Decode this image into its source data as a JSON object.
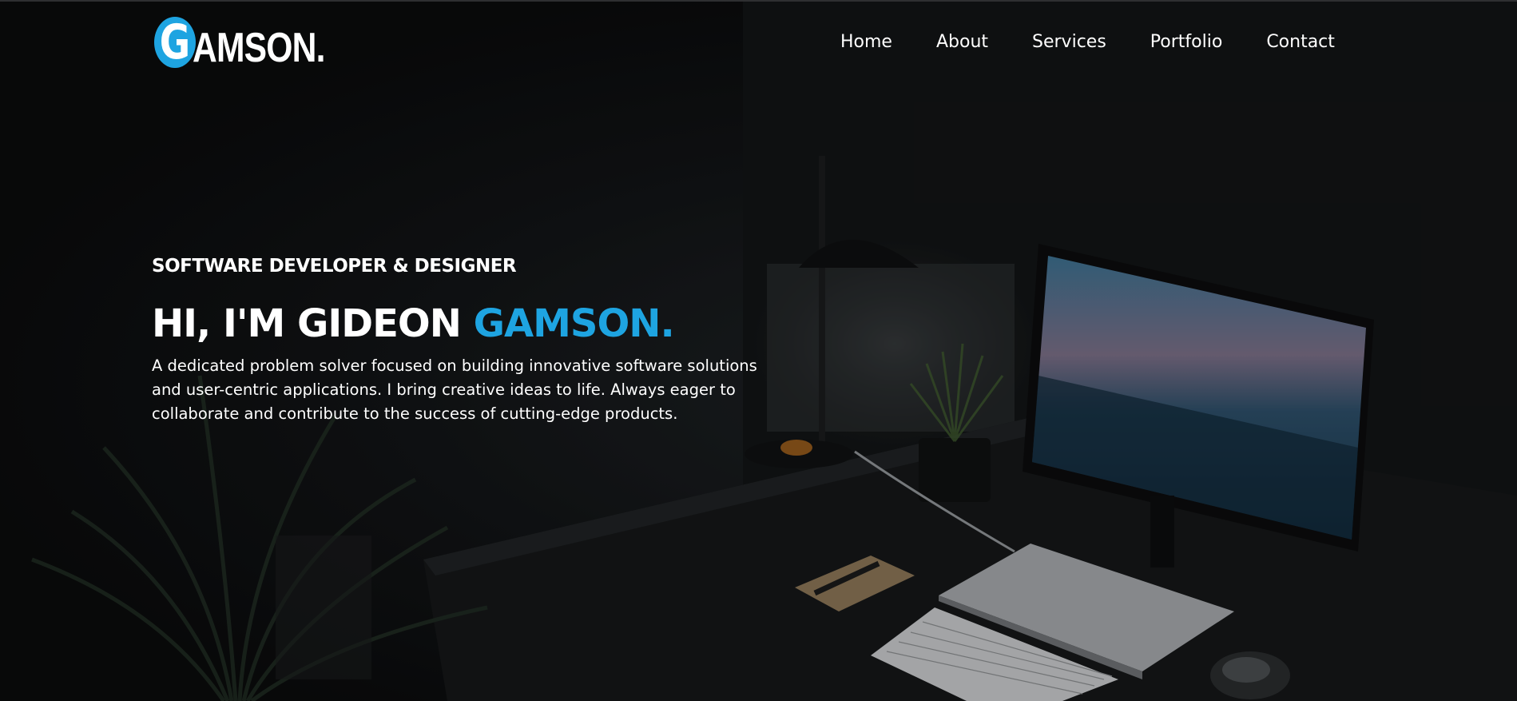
{
  "header": {
    "logo": {
      "letter": "G",
      "rest": "AMSON."
    },
    "nav": [
      "Home",
      "About",
      "Services",
      "Portfolio",
      "Contact"
    ]
  },
  "hero": {
    "subtitle": "SOFTWARE DEVELOPER & DESIGNER",
    "headline_prefix": "HI, I'M GIDEON ",
    "headline_accent": "GAMSON.",
    "description": "A dedicated problem solver focused on building innovative software solutions and user-centric applications. I bring creative ideas to life. Always eager to collaborate and contribute to the success of cutting-edge products."
  },
  "colors": {
    "accent": "#1ea4e1",
    "background": "#0b0c0d",
    "text": "#ffffff"
  }
}
